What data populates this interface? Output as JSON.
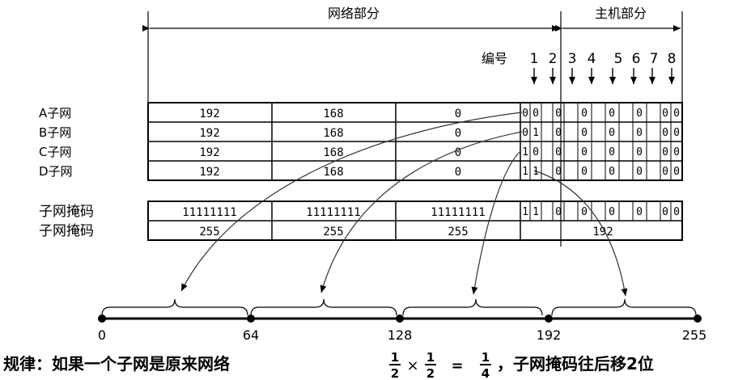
{
  "headers": {
    "network_part": "网络部分",
    "host_part": "主机部分"
  },
  "numbering": {
    "label": "编号",
    "bits": [
      "1",
      "2",
      "3",
      "4",
      "5",
      "6",
      "7",
      "8"
    ]
  },
  "subnets": [
    {
      "label": "A子网",
      "o1": "192",
      "o2": "168",
      "o3": "0",
      "bits": [
        "0",
        "0",
        "0",
        "0",
        "0",
        "0",
        "0",
        "0"
      ]
    },
    {
      "label": "B子网",
      "o1": "192",
      "o2": "168",
      "o3": "0",
      "bits": [
        "0",
        "1",
        "0",
        "0",
        "0",
        "0",
        "0",
        "0"
      ]
    },
    {
      "label": "C子网",
      "o1": "192",
      "o2": "168",
      "o3": "0",
      "bits": [
        "1",
        "0",
        "0",
        "0",
        "0",
        "0",
        "0",
        "0"
      ]
    },
    {
      "label": "D子网",
      "o1": "192",
      "o2": "168",
      "o3": "0",
      "bits": [
        "1",
        "1",
        "0",
        "0",
        "0",
        "0",
        "0",
        "0"
      ]
    }
  ],
  "mask_binary": {
    "label": "子网掩码",
    "o1": "11111111",
    "o2": "11111111",
    "o3": "11111111",
    "bits": [
      "1",
      "1",
      "0",
      "0",
      "0",
      "0",
      "0",
      "0"
    ]
  },
  "mask_decimal": {
    "label": "子网掩码",
    "o1": "255",
    "o2": "255",
    "o3": "255",
    "o4": "192"
  },
  "number_line": {
    "ticks": [
      "0",
      "64",
      "128",
      "192",
      "255"
    ]
  },
  "rule": {
    "prefix": "规律：如果一个子网是原来网络",
    "frac1_num": "1",
    "frac1_den": "2",
    "times": "×",
    "frac2_num": "1",
    "frac2_den": "2",
    "equals": "=",
    "frac3_num": "1",
    "frac3_den": "4",
    "suffix": "，子网掩码往后移2位"
  }
}
